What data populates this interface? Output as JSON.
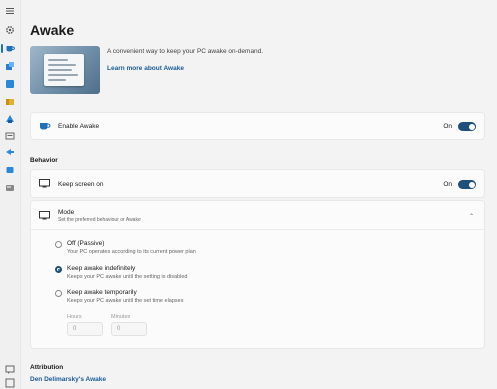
{
  "nav": {
    "items": [
      {
        "icon": "hamburger-menu-icon",
        "color": "#555555"
      },
      {
        "icon": "gear-icon",
        "color": "#555555"
      },
      {
        "icon": "awake-cup-icon",
        "color": "#1f6fbf"
      },
      {
        "icon": "always-on-top-icon",
        "color": "#2b7bd1"
      },
      {
        "icon": "color-picker-icon",
        "color": "#2b88d8"
      },
      {
        "icon": "fancyzones-icon",
        "color": "#2b88d8"
      },
      {
        "icon": "file-explorer-addons-icon",
        "color": "#e0b030"
      },
      {
        "icon": "image-resizer-icon",
        "color": "#2b88d8"
      },
      {
        "icon": "keyboard-manager-icon",
        "color": "#666666"
      },
      {
        "icon": "mouse-utilities-icon",
        "color": "#666666"
      },
      {
        "icon": "powerrename-icon",
        "color": "#2b88d8"
      },
      {
        "icon": "run-icon",
        "color": "#2b88d8"
      },
      {
        "icon": "shortcut-guide-icon",
        "color": "#666666"
      }
    ],
    "bottom_icon": "feedback-icon",
    "bottom_icon2": "welcome-icon"
  },
  "page": {
    "title": "Awake",
    "description": "A convenient way to keep your PC awake on-demand.",
    "learn_more": "Learn more about Awake"
  },
  "enable": {
    "label": "Enable Awake",
    "state": "On",
    "icon": "awake-cup-icon"
  },
  "behavior": {
    "heading": "Behavior",
    "keep_screen_on": {
      "label": "Keep screen on",
      "state": "On",
      "icon": "monitor-icon"
    },
    "mode": {
      "label": "Mode",
      "subtitle": "Set the preferred behaviour or Awake",
      "icon": "pc-monitor-icon",
      "options": [
        {
          "title": "Off (Passive)",
          "subtitle": "Your PC operates according to its current power plan",
          "selected": false
        },
        {
          "title": "Keep awake indefinitely",
          "subtitle": "Keeps your PC awake until the setting is disabled",
          "selected": true
        },
        {
          "title": "Keep awake temporarily",
          "subtitle": "Keeps your PC awake until the set time elapses",
          "selected": false
        }
      ],
      "hours_label": "Hours",
      "hours_value": "0",
      "minutes_label": "Minutes",
      "minutes_value": "0"
    }
  },
  "attribution": {
    "heading": "Attribution",
    "link": "Den Delimarsky's Awake"
  },
  "accent": "#1f4f7a"
}
